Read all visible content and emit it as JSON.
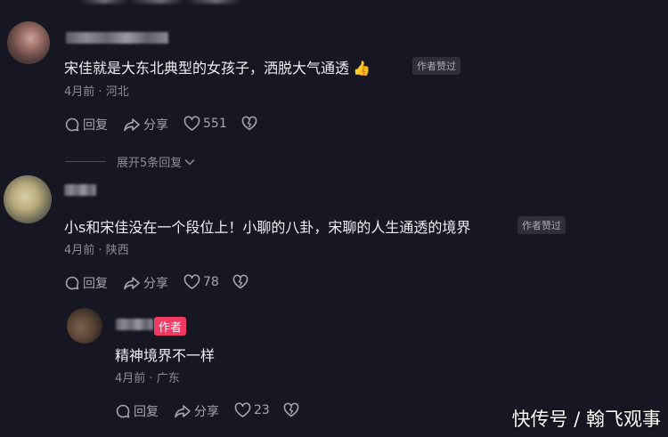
{
  "comments": [
    {
      "text": "宋佳就是大东北典型的女孩子，洒脱大气通透",
      "emoji": "👍",
      "badge": "作者赞过",
      "time": "4月前",
      "location": "河北",
      "reply_label": "回复",
      "share_label": "分享",
      "likes": "551",
      "expand_label": "展开5条回复"
    },
    {
      "text": "小s和宋佳没在一个段位上！小聊的八卦，宋聊的人生通透的境界",
      "badge": "作者赞过",
      "time": "4月前",
      "location": "陕西",
      "reply_label": "回复",
      "share_label": "分享",
      "likes": "78",
      "reply": {
        "author_tag": "作者",
        "text": "精神境界不一样",
        "time": "4月前",
        "location": "广东",
        "reply_label": "回复",
        "share_label": "分享",
        "likes": "23"
      }
    }
  ],
  "watermark": "快传号 / 翰飞观事",
  "colors": {
    "background": "#161722",
    "author_tag": "#f03a64"
  },
  "icons": [
    "comment-icon",
    "share-icon",
    "heart-icon",
    "dislike-icon",
    "chevron-down-icon"
  ]
}
